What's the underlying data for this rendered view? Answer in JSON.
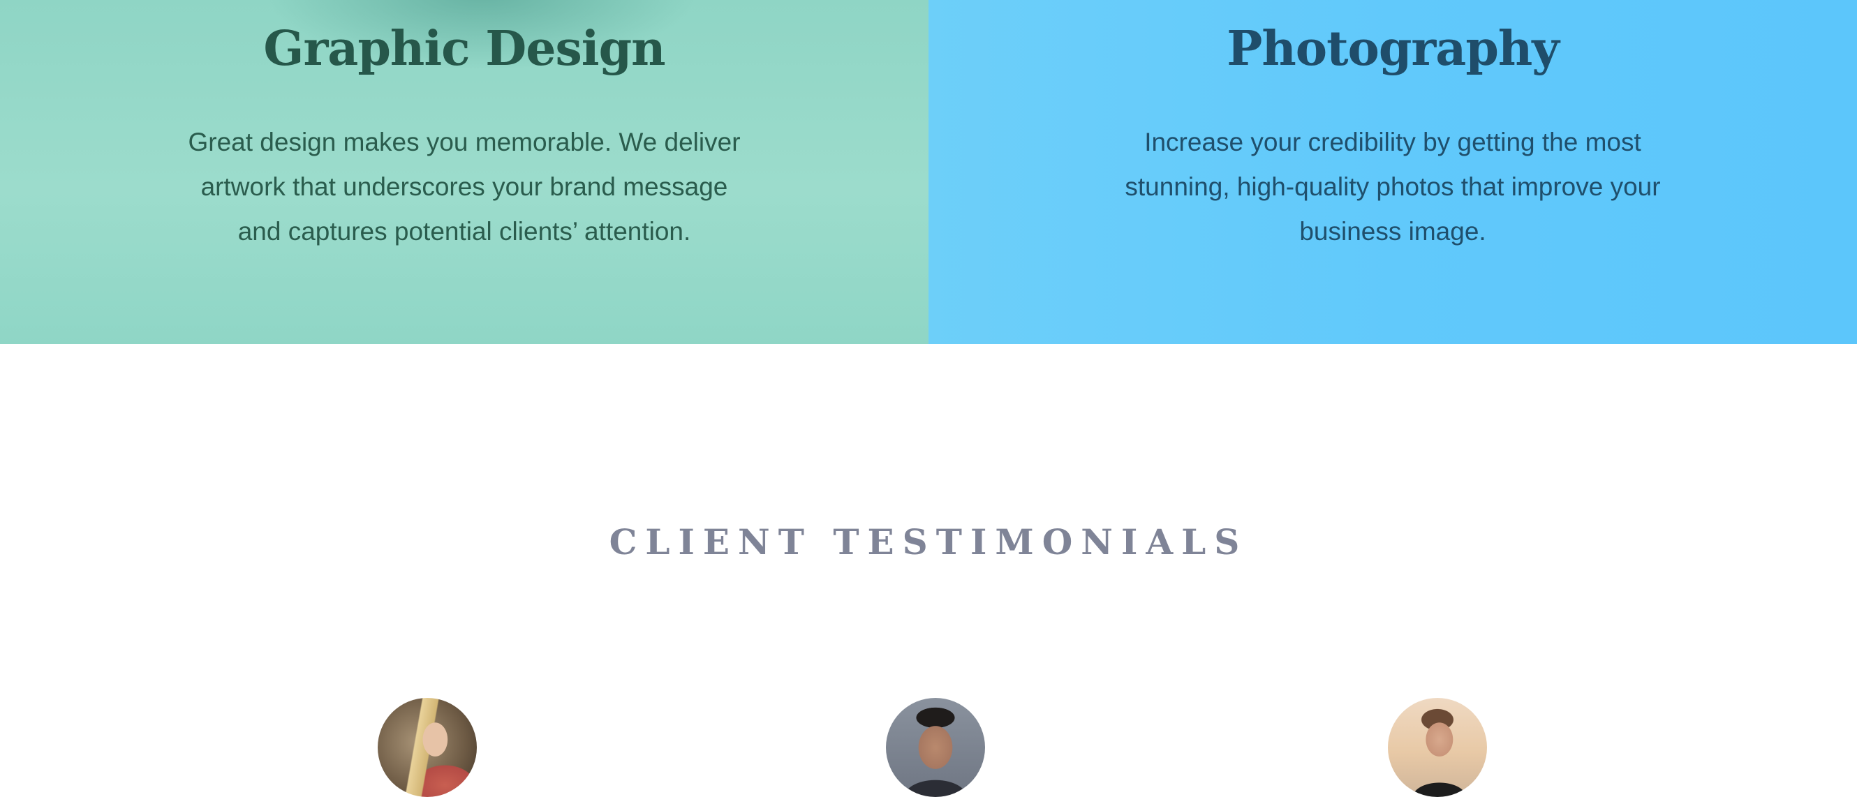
{
  "services": [
    {
      "title": "Graphic Design",
      "description": "Great design makes you memorable. We deliver artwork that underscores your brand message and captures potential clients’ attention."
    },
    {
      "title": "Photography",
      "description": "Increase your credibility by getting the most stunning, high-quality photos that improve your business image."
    }
  ],
  "testimonials": {
    "heading": "CLIENT TESTIMONIALS"
  },
  "colors": {
    "design_panel_bg": "#94d8c8",
    "photo_panel_bg": "#64cbfa",
    "design_text": "#26574a",
    "photo_text": "#1f4d6a",
    "testimonials_heading": "#7f8497"
  }
}
